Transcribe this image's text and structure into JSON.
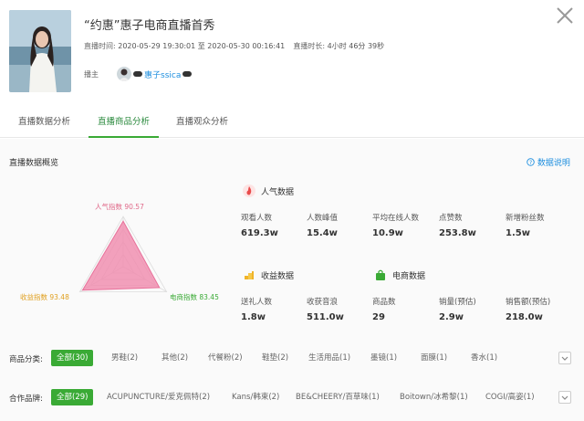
{
  "header": {
    "title": "“约惠”惠子电商直播首秀",
    "time_label": "直播时间:",
    "time_value": "2020-05-29 19:30:01 至 2020-05-30 00:16:41",
    "duration_label": "直播时长:",
    "duration_value": "4小时 46分 39秒",
    "anchor_label": "播主",
    "anchor_name": "惠子ssica"
  },
  "tabs": [
    "直播数据分析",
    "直播商品分析",
    "直播观众分析"
  ],
  "active_tab": 1,
  "overview": {
    "title": "直播数据概览",
    "help_label": "数据说明"
  },
  "chart_data": {
    "type": "radar",
    "axes": [
      {
        "label": "人气指数",
        "value": 90.57
      },
      {
        "label": "电商指数",
        "value": 83.45
      },
      {
        "label": "收益指数",
        "value": 93.48
      }
    ],
    "range": [
      0,
      100
    ]
  },
  "radar_labels": {
    "popularity": "人气指数 90.57",
    "ecommerce": "电商指数 83.45",
    "revenue": "收益指数 93.48"
  },
  "popularity": {
    "title": "人气数据",
    "stats": [
      {
        "label": "观看人数",
        "value": "619.3w"
      },
      {
        "label": "人数峰值",
        "value": "15.4w"
      },
      {
        "label": "平均在线人数",
        "value": "10.9w"
      },
      {
        "label": "点赞数",
        "value": "253.8w"
      },
      {
        "label": "新增粉丝数",
        "value": "1.5w"
      }
    ]
  },
  "revenue": {
    "title": "收益数据",
    "stats": [
      {
        "label": "送礼人数",
        "value": "1.8w"
      },
      {
        "label": "收获音浪",
        "value": "511.0w"
      }
    ]
  },
  "ecommerce": {
    "title": "电商数据",
    "stats": [
      {
        "label": "商品数",
        "value": "29"
      },
      {
        "label": "销量(预估)",
        "value": "2.9w"
      },
      {
        "label": "销售额(预估)",
        "value": "218.0w"
      }
    ]
  },
  "category_filter": {
    "label": "商品分类:",
    "chips": [
      "全部(30)",
      "男鞋(2)",
      "其他(2)",
      "代餐粉(2)",
      "鞋垫(2)",
      "生活用品(1)",
      "墨镜(1)",
      "面膜(1)",
      "香水(1)"
    ]
  },
  "brand_filter": {
    "label": "合作品牌:",
    "chips": [
      "全部(29)",
      "ACUPUNCTURE/爱克佩特(2)",
      "Kans/韩束(2)",
      "BE&CHEERY/百草味(1)",
      "Boitown/冰希黎(1)",
      "COGI/高姿(1)"
    ]
  },
  "colors": {
    "accent": "#3aaa35",
    "link": "#1f8fdf",
    "radar_fill": "#f08fb0",
    "popularity_label": "#e06a8a",
    "ecommerce_label": "#3aaa35",
    "revenue_label": "#e0a020"
  },
  "icons": {
    "popularity": "flame-icon",
    "revenue": "coins-icon",
    "ecommerce": "shopping-bag-icon",
    "help": "question-circle-icon",
    "close": "close-icon",
    "expand": "chevron-down-icon"
  }
}
